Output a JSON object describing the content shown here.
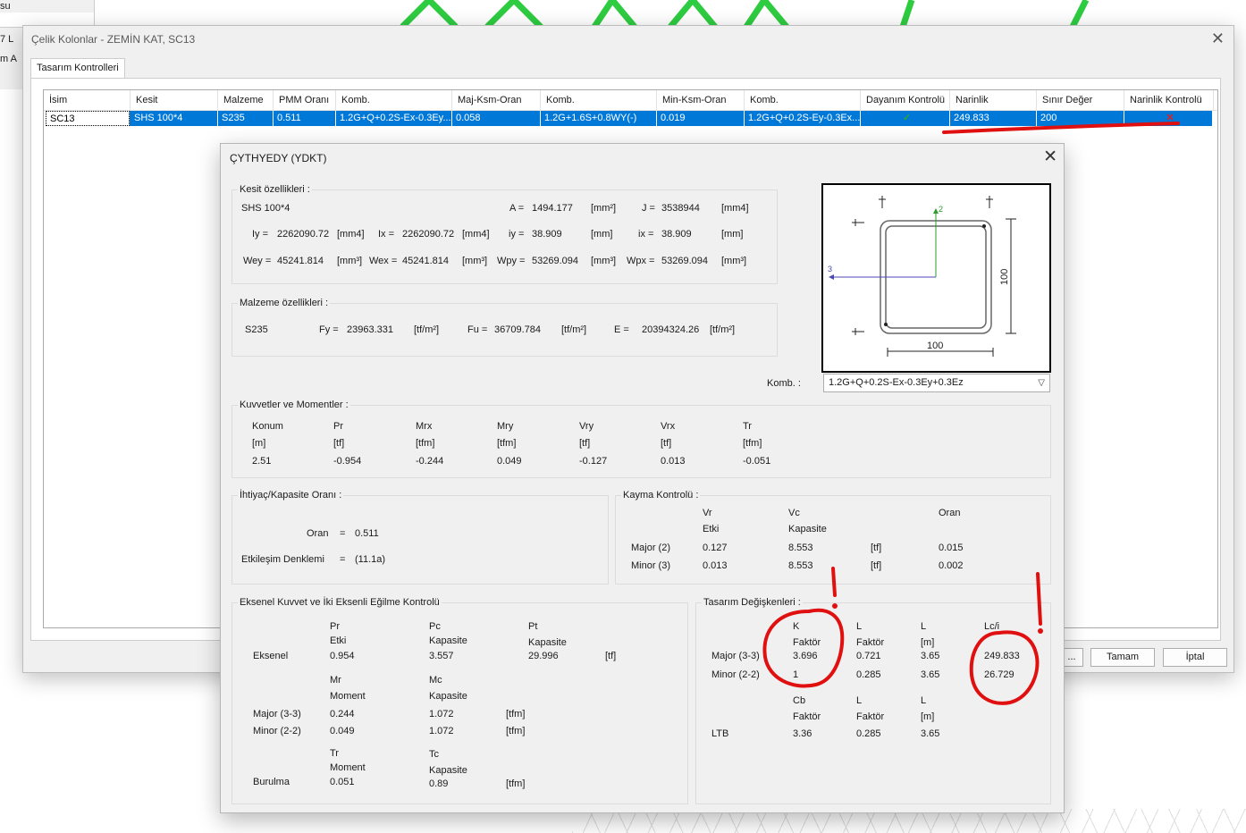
{
  "background": {
    "left_fragment": {
      "title": "su",
      "row1": "7  L",
      "row2": "m  A"
    }
  },
  "main_window": {
    "title": "Çelik Kolonlar - ZEMİN KAT, SC13",
    "tab": "Tasarım Kontrolleri",
    "columns": [
      "İsim",
      "Kesit",
      "Malzeme",
      "PMM Oranı",
      "Komb.",
      "Maj-Ksm-Oran",
      "Komb.",
      "Min-Ksm-Oran",
      "Komb.",
      "Dayanım Kontrolü",
      "Narinlik",
      "Sınır Değer",
      "Narinlik Kontrolü"
    ],
    "row": {
      "name": "SC13",
      "section": "SHS 100*4",
      "material": "S235",
      "pmm": "0.511",
      "comb1": "1.2G+Q+0.2S-Ex-0.3Ey...",
      "maj": "0.058",
      "comb2": "1.2G+1.6S+0.8WY(-)",
      "min": "0.019",
      "comb3": "1.2G+Q+0.2S-Ey-0.3Ex...",
      "strength_check": "✓",
      "slenderness": "249.833",
      "limit": "200",
      "slenderness_check": "✕"
    },
    "buttons": {
      "ok": "Tamam",
      "cancel": "İptal",
      "partial": "..."
    }
  },
  "dialog": {
    "title": "ÇYTHYEDY (YDKT)",
    "section_props": {
      "title": "Kesit özellikleri :",
      "name": "SHS 100*4",
      "A": {
        "label": "A =",
        "value": "1494.177",
        "unit": "[mm²]"
      },
      "J": {
        "label": "J =",
        "value": "3538944",
        "unit": "[mm4]"
      },
      "Iy": {
        "label": "Iy =",
        "value": "2262090.72",
        "unit": "[mm4]"
      },
      "Ix": {
        "label": "Ix =",
        "value": "2262090.72",
        "unit": "[mm4]"
      },
      "iy": {
        "label": "iy =",
        "value": "38.909",
        "unit": "[mm]"
      },
      "ix": {
        "label": "ix =",
        "value": "38.909",
        "unit": "[mm]"
      },
      "Wey": {
        "label": "Wey =",
        "value": "45241.814",
        "unit": "[mm³]"
      },
      "Wex": {
        "label": "Wex =",
        "value": "45241.814",
        "unit": "[mm³]"
      },
      "Wpy": {
        "label": "Wpy =",
        "value": "53269.094",
        "unit": "[mm³]"
      },
      "Wpx": {
        "label": "Wpx =",
        "value": "53269.094",
        "unit": "[mm³]"
      }
    },
    "material_props": {
      "title": "Malzeme özellikleri :",
      "name": "S235",
      "Fy": {
        "label": "Fy =",
        "value": "23963.331",
        "unit": "[tf/m²]"
      },
      "Fu": {
        "label": "Fu =",
        "value": "36709.784",
        "unit": "[tf/m²]"
      },
      "E": {
        "label": "E =",
        "value": "20394324.26",
        "unit": "[tf/m²]"
      }
    },
    "drawing": {
      "dim_w": "100",
      "dim_h": "100",
      "axis2": "2",
      "axis3": "3"
    },
    "komb": {
      "label": "Komb. :",
      "value": "1.2G+Q+0.2S-Ex-0.3Ey+0.3Ez"
    },
    "forces": {
      "title": "Kuvvetler ve Momentler :",
      "headers": [
        "Konum",
        "Pr",
        "Mrx",
        "Mry",
        "Vry",
        "Vrx",
        "Tr"
      ],
      "units": [
        "[m]",
        "[tf]",
        "[tfm]",
        "[tfm]",
        "[tf]",
        "[tf]",
        "[tfm]"
      ],
      "values": [
        "2.51",
        "-0.954",
        "-0.244",
        "0.049",
        "-0.127",
        "0.013",
        "-0.051"
      ]
    },
    "ratio": {
      "title": "İhtiyaç/Kapasite Oranı :",
      "oran_label": "Oran",
      "eq": "=",
      "oran_value": "0.511",
      "etk_label": "Etkileşim Denklemi",
      "etk_value": "(11.1a)"
    },
    "shear": {
      "title": "Kayma Kontrolü :",
      "h_vr": "Vr",
      "h_etki": "Etki",
      "h_vc": "Vc",
      "h_kap": "Kapasite",
      "h_oran": "Oran",
      "rows": [
        {
          "label": "Major (2)",
          "vr": "0.127",
          "vc": "8.553",
          "unit": "[tf]",
          "oran": "0.015"
        },
        {
          "label": "Minor (3)",
          "vr": "0.013",
          "vc": "8.553",
          "unit": "[tf]",
          "oran": "0.002"
        }
      ]
    },
    "axial": {
      "title": "Eksenel Kuvvet ve İki Eksenli Eğilme Kontrolü",
      "pr": "Pr",
      "etki": "Etki",
      "pc": "Pc",
      "kap": "Kapasite",
      "pt": "Pt",
      "eksenel": "Eksenel",
      "pr_v": "0.954",
      "pc_v": "3.557",
      "pt_v": "29.996",
      "unit_tf": "[tf]",
      "mr": "Mr",
      "moment": "Moment",
      "mc": "Mc",
      "major": "Major (3-3)",
      "major_mr": "0.244",
      "major_mc": "1.072",
      "minor": "Minor (2-2)",
      "minor_mr": "0.049",
      "minor_mc": "1.072",
      "unit_tfm": "[tfm]",
      "tr": "Tr",
      "tc": "Tc",
      "burulma": "Burulma",
      "tr_v": "0.051",
      "tc_v": "0.89"
    },
    "design": {
      "title": "Tasarım Değişkenleri :",
      "h_k": "K",
      "h_faktor": "Faktör",
      "h_l": "L",
      "h_lm": "[m]",
      "h_lci": "Lc/i",
      "major": "Major (3-3)",
      "major_k": "3.696",
      "major_lf": "0.721",
      "major_l": "3.65",
      "major_lci": "249.833",
      "minor": "Minor (2-2)",
      "minor_k": "1",
      "minor_lf": "0.285",
      "minor_l": "3.65",
      "minor_lci": "26.729",
      "h_cb": "Cb",
      "ltb": "LTB",
      "ltb_cb": "3.36",
      "ltb_lf": "0.285",
      "ltb_l": "3.65"
    }
  },
  "colors": {
    "selection": "#0078d7",
    "annotation": "#e01010",
    "beam": "#2ecc40"
  }
}
